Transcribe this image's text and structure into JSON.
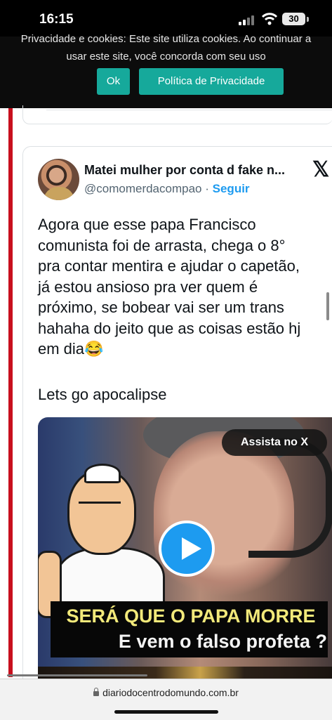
{
  "status_bar": {
    "time": "16:15",
    "battery": "30"
  },
  "cookie_banner": {
    "text_line1": "Privacidade e cookies: Este site utiliza cookies. Ao continuar a",
    "text_line2": "usar este site, você concorda com seu uso",
    "ok_label": "Ok",
    "policy_label": "Política de Privacidade"
  },
  "tweet": {
    "author_name": "Matei mulher por conta d fake n...",
    "handle": "@comomerdacompao",
    "separator": "·",
    "follow_label": "Seguir",
    "text_lines": [
      "Agora que esse papa Francisco",
      "comunista foi de arrasta, chega o 8°",
      "pra contar mentira e ajudar o capetão,",
      "já estou ansioso pra ver quem é",
      "próximo, se bobear vai ser um trans",
      "hahaha do jeito que as coisas estão hj",
      "em dia😂"
    ],
    "text_line_last": "Lets go apocalipse",
    "media": {
      "watch_label": "Assista no X",
      "caption_line1": "SERÁ QUE O PAPA MORRE",
      "caption_line2": "E vem o falso profeta ?"
    }
  },
  "browser": {
    "url": "diariodocentrodomundo.com.br"
  },
  "colors": {
    "accent": "#16a99b",
    "link": "#1d9bf0",
    "sidebar": "#c8101e"
  }
}
